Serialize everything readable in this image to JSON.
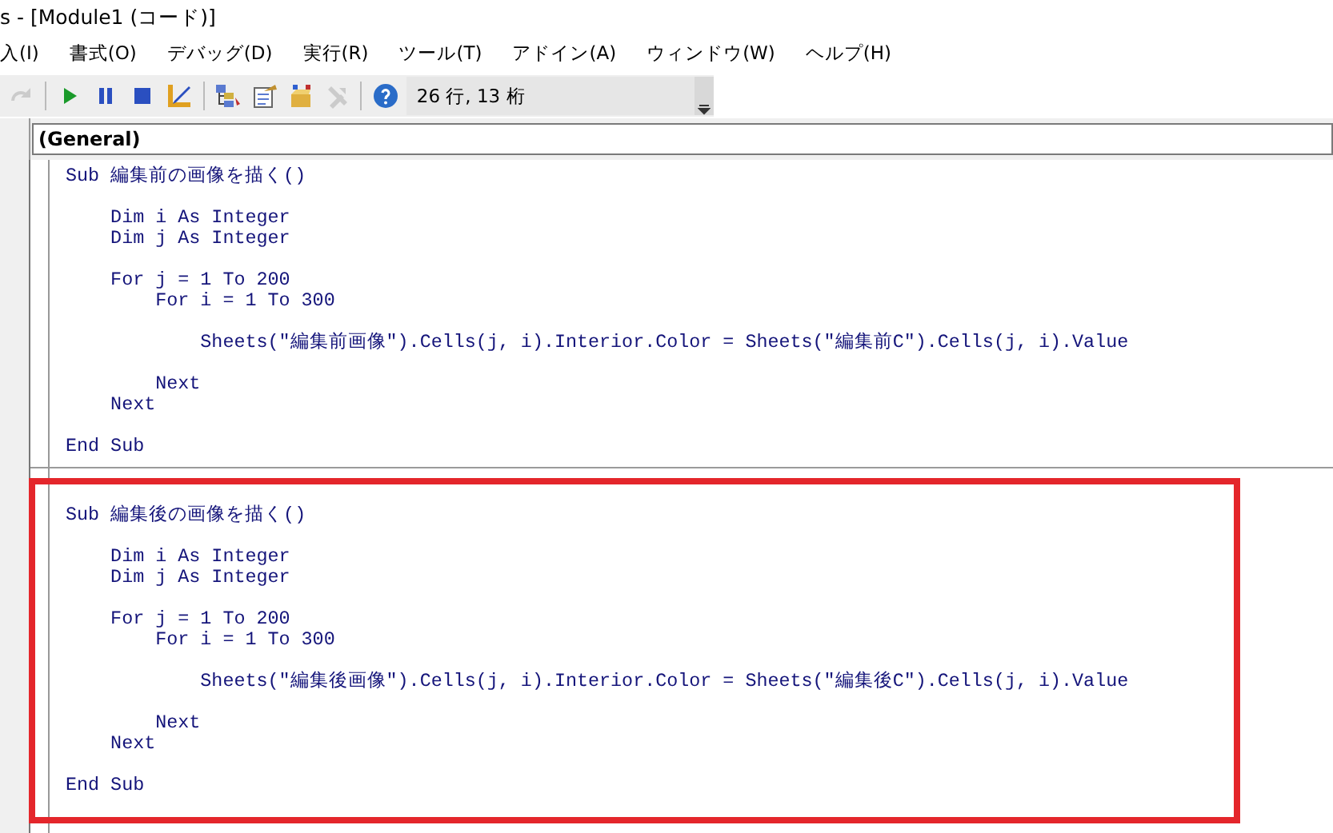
{
  "window": {
    "title": "s - [Module1 (コード)]"
  },
  "menu": [
    {
      "label": "入(I)"
    },
    {
      "label": "書式(O)"
    },
    {
      "label": "デバッグ(D)"
    },
    {
      "label": "実行(R)"
    },
    {
      "label": "ツール(T)"
    },
    {
      "label": "アドイン(A)"
    },
    {
      "label": "ウィンドウ(W)"
    },
    {
      "label": "ヘルプ(H)"
    }
  ],
  "toolbar": [
    {
      "kind": "redo",
      "disabled": true
    },
    {
      "kind": "separator"
    },
    {
      "kind": "run",
      "disabled": false
    },
    {
      "kind": "pause",
      "disabled": false
    },
    {
      "kind": "stop",
      "disabled": false
    },
    {
      "kind": "design",
      "disabled": false
    },
    {
      "kind": "separator"
    },
    {
      "kind": "explorer",
      "disabled": false
    },
    {
      "kind": "properties",
      "disabled": false
    },
    {
      "kind": "browser",
      "disabled": false
    },
    {
      "kind": "toolbox",
      "disabled": true
    },
    {
      "kind": "separator"
    },
    {
      "kind": "help",
      "disabled": false
    }
  ],
  "status": {
    "position": "26 行, 13 桁"
  },
  "object_box": {
    "value": "(General)"
  },
  "procedures": [
    {
      "highlighted": false,
      "blocks": [
        [
          "Sub 編集前の画像を描く()"
        ],
        [
          "    Dim i As Integer",
          "    Dim j As Integer"
        ],
        [
          "    For j = 1 To 200",
          "        For i = 1 To 300"
        ],
        [
          "            Sheets(\"編集前画像\").Cells(j, i).Interior.Color = Sheets(\"編集前C\").Cells(j, i).Value"
        ],
        [
          "        Next",
          "    Next"
        ],
        [
          "End Sub"
        ]
      ]
    },
    {
      "highlighted": true,
      "blocks": [
        [
          "Sub 編集後の画像を描く()"
        ],
        [
          "    Dim i As Integer",
          "    Dim j As Integer"
        ],
        [
          "    For j = 1 To 200",
          "        For i = 1 To 300"
        ],
        [
          "            Sheets(\"編集後画像\").Cells(j, i).Interior.Color = Sheets(\"編集後C\").Cells(j, i).Value"
        ],
        [
          "        Next",
          "    Next"
        ],
        [
          "End Sub"
        ]
      ]
    }
  ]
}
